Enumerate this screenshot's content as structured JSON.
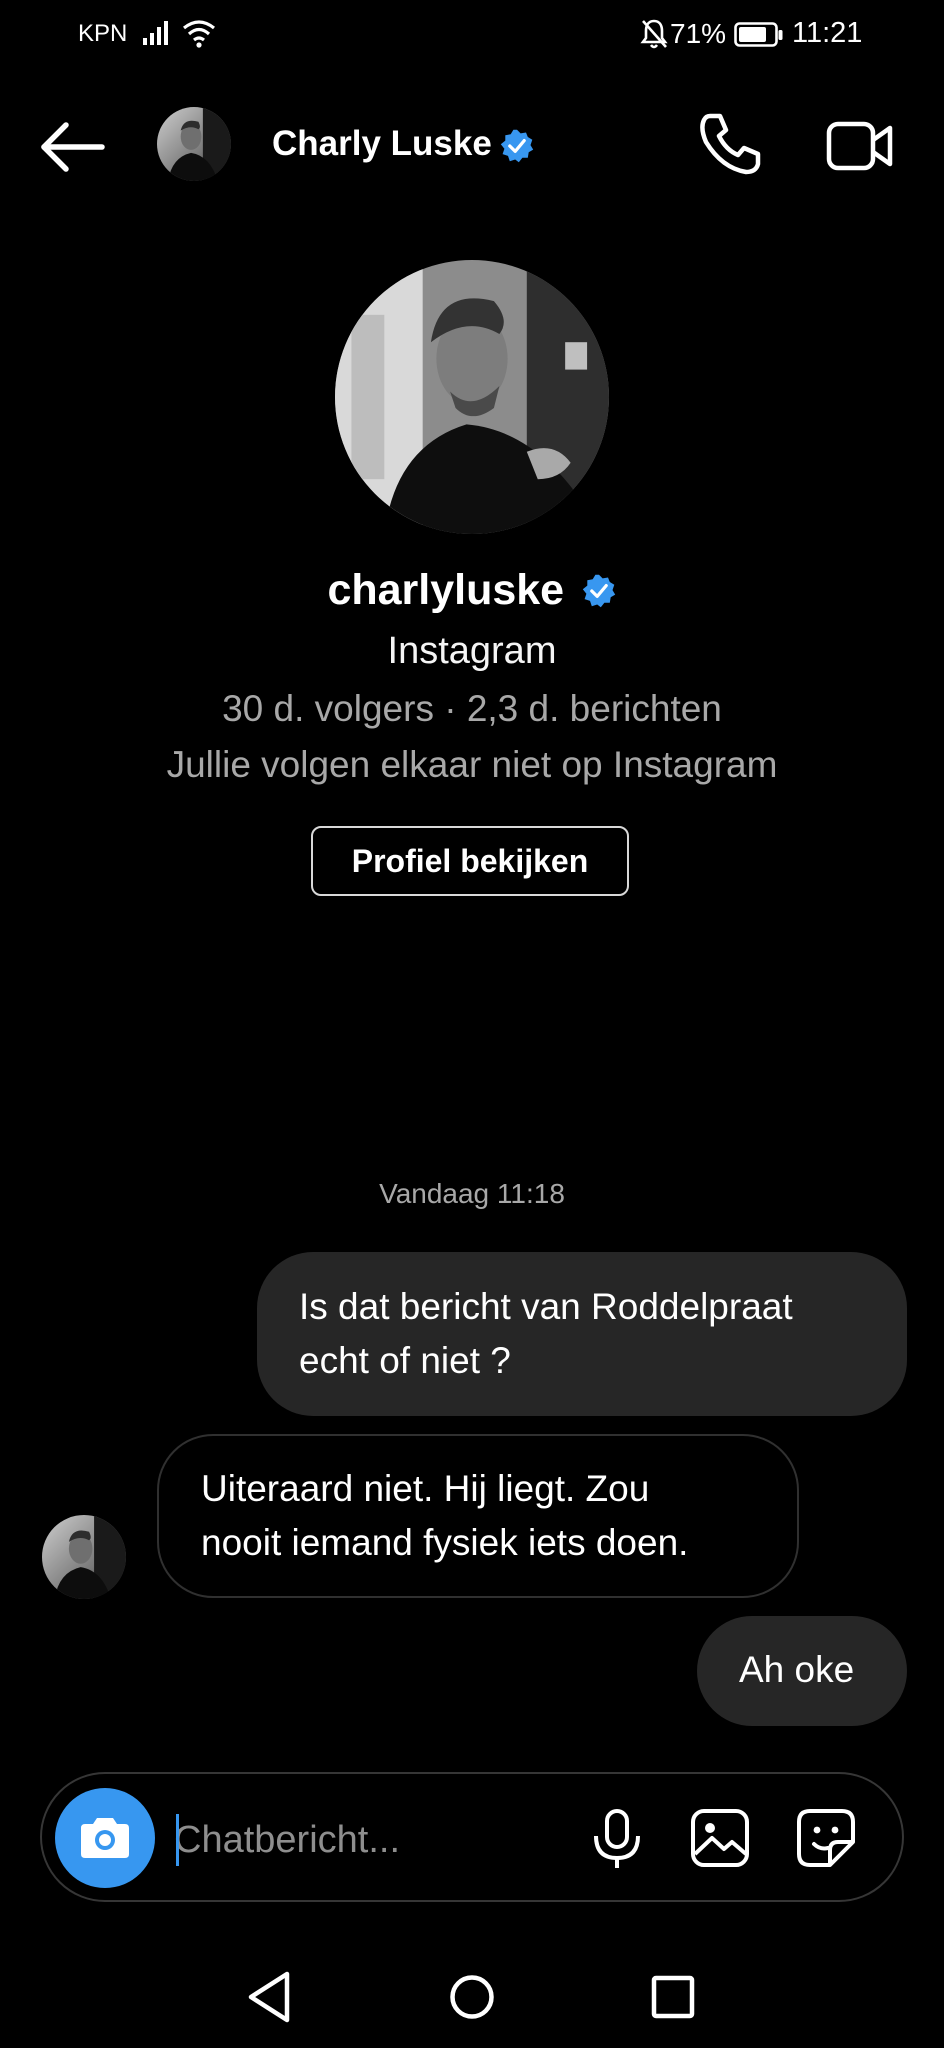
{
  "status_bar": {
    "carrier": "KPN",
    "battery_percent": "71%",
    "time": "11:21",
    "icons": [
      "signal-icon",
      "wifi-icon",
      "mute-icon",
      "battery-icon"
    ]
  },
  "header": {
    "contact_name": "Charly Luske",
    "verified": true,
    "icons": [
      "back-arrow-icon",
      "phone-icon",
      "video-camera-icon",
      "verified-badge-icon"
    ]
  },
  "profile": {
    "username": "charlyluske",
    "platform": "Instagram",
    "stats": "30 d. volgers · 2,3 d. berichten",
    "follow_note": "Jullie volgen elkaar niet op Instagram",
    "view_profile_label": "Profiel bekijken"
  },
  "chat": {
    "timestamp": "Vandaag 11:18",
    "messages": [
      {
        "direction": "sent",
        "lines": [
          "Is dat bericht van Roddelpraat",
          "echt of niet ?"
        ]
      },
      {
        "direction": "received",
        "lines": [
          "Uiteraard niet. Hij liegt. Zou",
          "nooit iemand fysiek iets doen."
        ]
      },
      {
        "direction": "sent",
        "lines": [
          "Ah oke"
        ]
      }
    ]
  },
  "composer": {
    "placeholder": "Chatbericht...",
    "value": "",
    "icons": [
      "camera-icon",
      "microphone-icon",
      "gallery-icon",
      "sticker-icon"
    ]
  },
  "nav_bar": {
    "icons": [
      "nav-back-icon",
      "nav-home-icon",
      "nav-recent-icon"
    ]
  },
  "colors": {
    "background": "#000000",
    "sent_bubble": "#262626",
    "accent_blue": "#3797f0",
    "verified_blue": "#3897f0",
    "muted_text": "#a8a8a8"
  }
}
